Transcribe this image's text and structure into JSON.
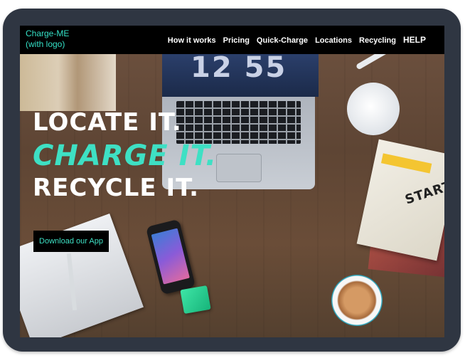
{
  "nav": {
    "brand": "Charge-ME\n(with logo)",
    "brand_line1": "Charge-ME",
    "brand_line2": "(with logo)",
    "links": [
      "How it works",
      "Pricing",
      "Quick-Charge",
      "Locations",
      "Recycling",
      "HELP"
    ]
  },
  "hero": {
    "line1": "LOCATE IT.",
    "line2": "CHARGE IT.",
    "line3": "RECYCLE IT.",
    "cta": "Download our App"
  },
  "scene": {
    "laptop_time": "12 55",
    "book_title": "STARTUP"
  },
  "colors": {
    "accent": "#3ee0c4",
    "nav_bg": "#000000",
    "frame": "#2f3642"
  }
}
